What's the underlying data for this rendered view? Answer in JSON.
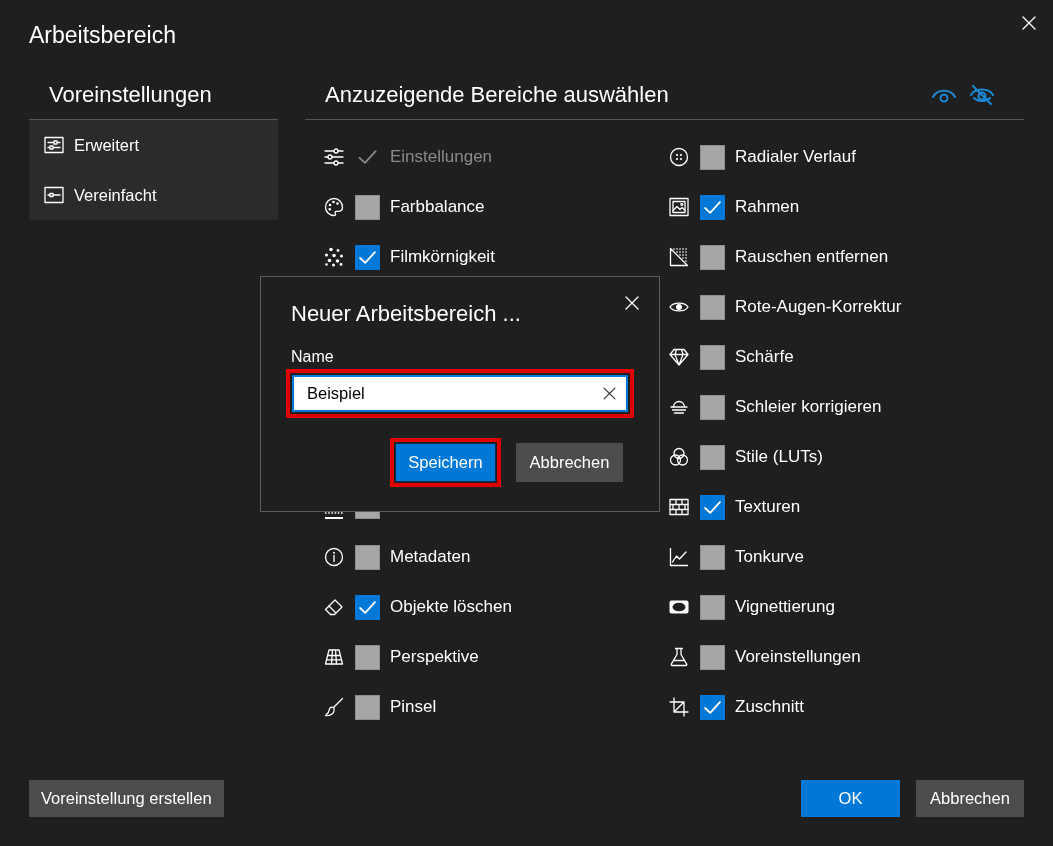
{
  "window": {
    "title": "Arbeitsbereich"
  },
  "presets": {
    "heading": "Voreinstellungen",
    "items": [
      {
        "label": "Erweitert"
      },
      {
        "label": "Vereinfacht"
      }
    ]
  },
  "areas": {
    "heading": "Anzuzeigende Bereiche auswählen",
    "column_1": {
      "above_dialog": [
        {
          "label": "Einstellungen",
          "checked": true,
          "disabled": true
        },
        {
          "label": "Farbbalance",
          "checked": false,
          "disabled": false
        },
        {
          "label": "Filmkörnigkeit",
          "checked": true,
          "disabled": false
        }
      ],
      "below_dialog": [
        {
          "checked": false,
          "disabled": false
        },
        {
          "label": "Metadaten",
          "checked": false,
          "disabled": false
        },
        {
          "label": "Objekte löschen",
          "checked": true,
          "disabled": false
        },
        {
          "label": "Perspektive",
          "checked": false,
          "disabled": false
        },
        {
          "label": "Pinsel",
          "checked": false,
          "disabled": false
        }
      ]
    },
    "column_2": [
      {
        "label": "Radialer Verlauf",
        "checked": false,
        "disabled": false
      },
      {
        "label": "Rahmen",
        "checked": true,
        "disabled": false
      },
      {
        "label": "Rauschen entfernen",
        "checked": false,
        "disabled": false
      },
      {
        "label": "Rote-Augen-Korrektur",
        "checked": false,
        "disabled": false
      },
      {
        "label": "Schärfe",
        "checked": false,
        "disabled": false
      },
      {
        "label": "Schleier korrigieren",
        "checked": false,
        "disabled": false
      },
      {
        "label": "Stile (LUTs)",
        "checked": false,
        "disabled": false
      },
      {
        "label": "Texturen",
        "checked": true,
        "disabled": false
      },
      {
        "label": "Tonkurve",
        "checked": false,
        "disabled": false
      },
      {
        "label": "Vignettierung",
        "checked": false,
        "disabled": false
      },
      {
        "label": "Voreinstellungen",
        "checked": false,
        "disabled": false
      },
      {
        "label": "Zuschnitt",
        "checked": true,
        "disabled": false
      }
    ]
  },
  "footer": {
    "create_preset_button": "Voreinstellung erstellen",
    "ok_button": "OK",
    "cancel_button": "Abbrechen"
  },
  "dialog": {
    "title": "Neuer Arbeitsbereich ...",
    "field_label": "Name",
    "name_field": {
      "value": "Beispiel",
      "highlighted": true
    },
    "save_button": {
      "label": "Speichern",
      "highlighted": true
    },
    "cancel_button": {
      "label": "Abbrechen",
      "highlighted": false
    }
  }
}
